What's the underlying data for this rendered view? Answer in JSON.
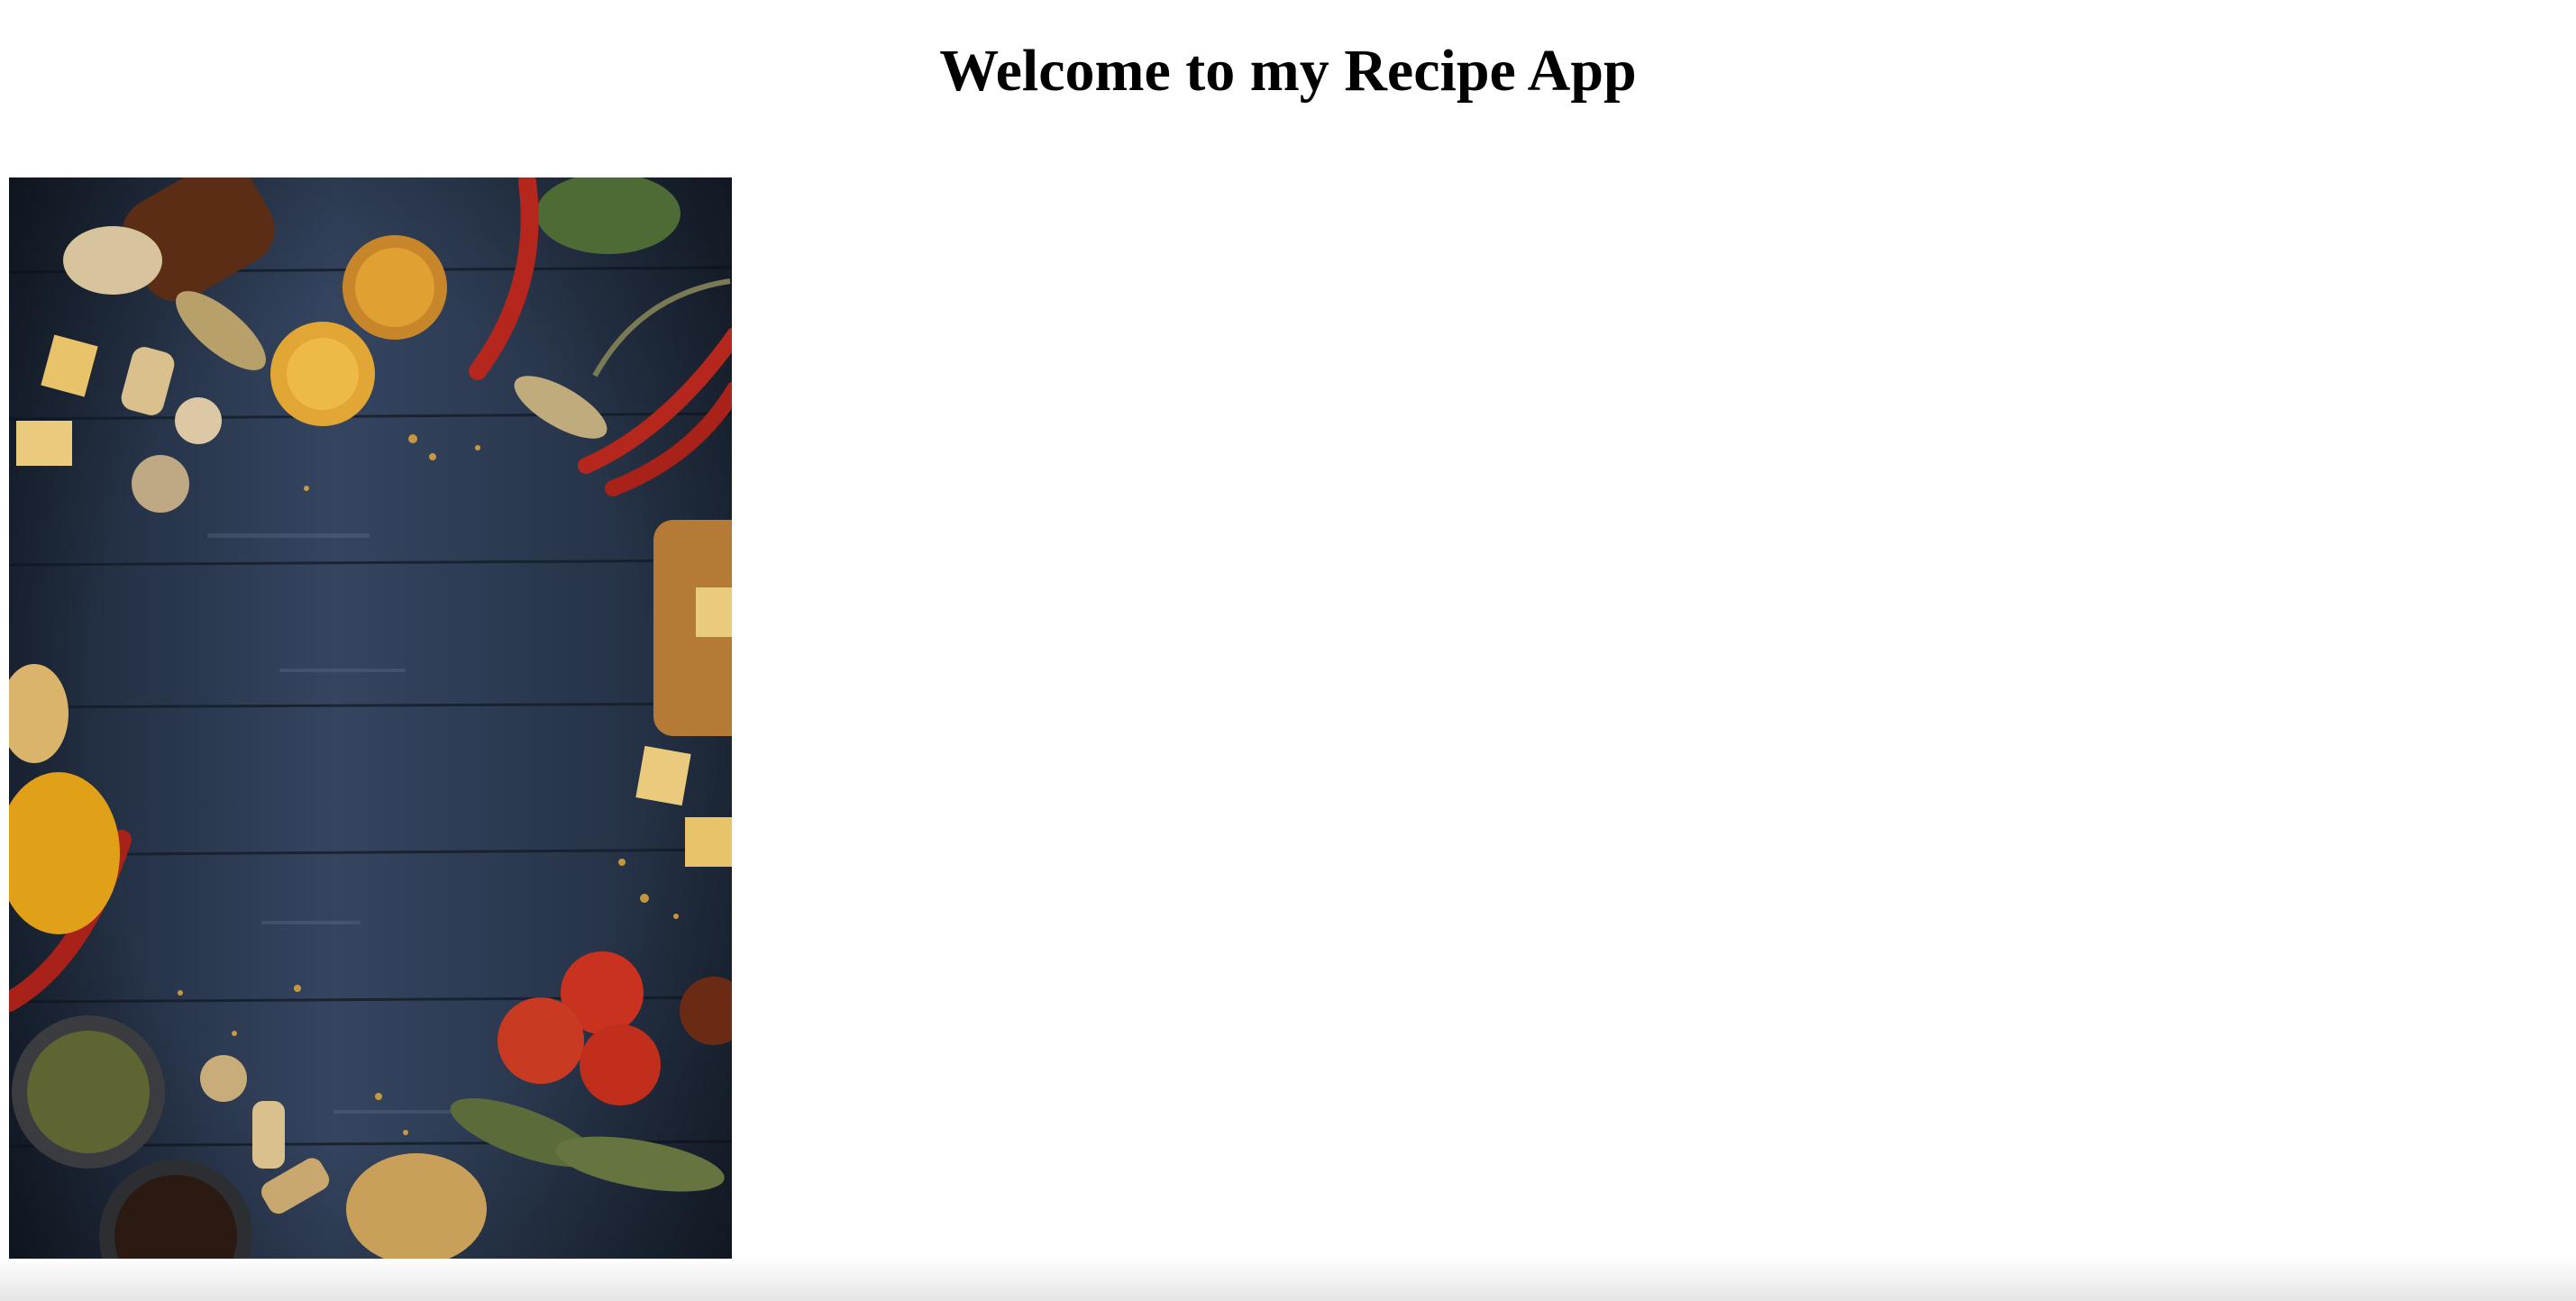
{
  "page": {
    "heading": "Welcome to my Recipe App"
  },
  "hero_image": {
    "subject": "food-ingredients-on-wooden-table",
    "colors": {
      "board_dark": "#1e2a3a",
      "board_light": "#34445a",
      "tomato": "#c8321e",
      "chili": "#b5261c",
      "cheese": "#e8c36a",
      "lemon": "#e2a634",
      "leaf": "#6e7a4a"
    }
  }
}
